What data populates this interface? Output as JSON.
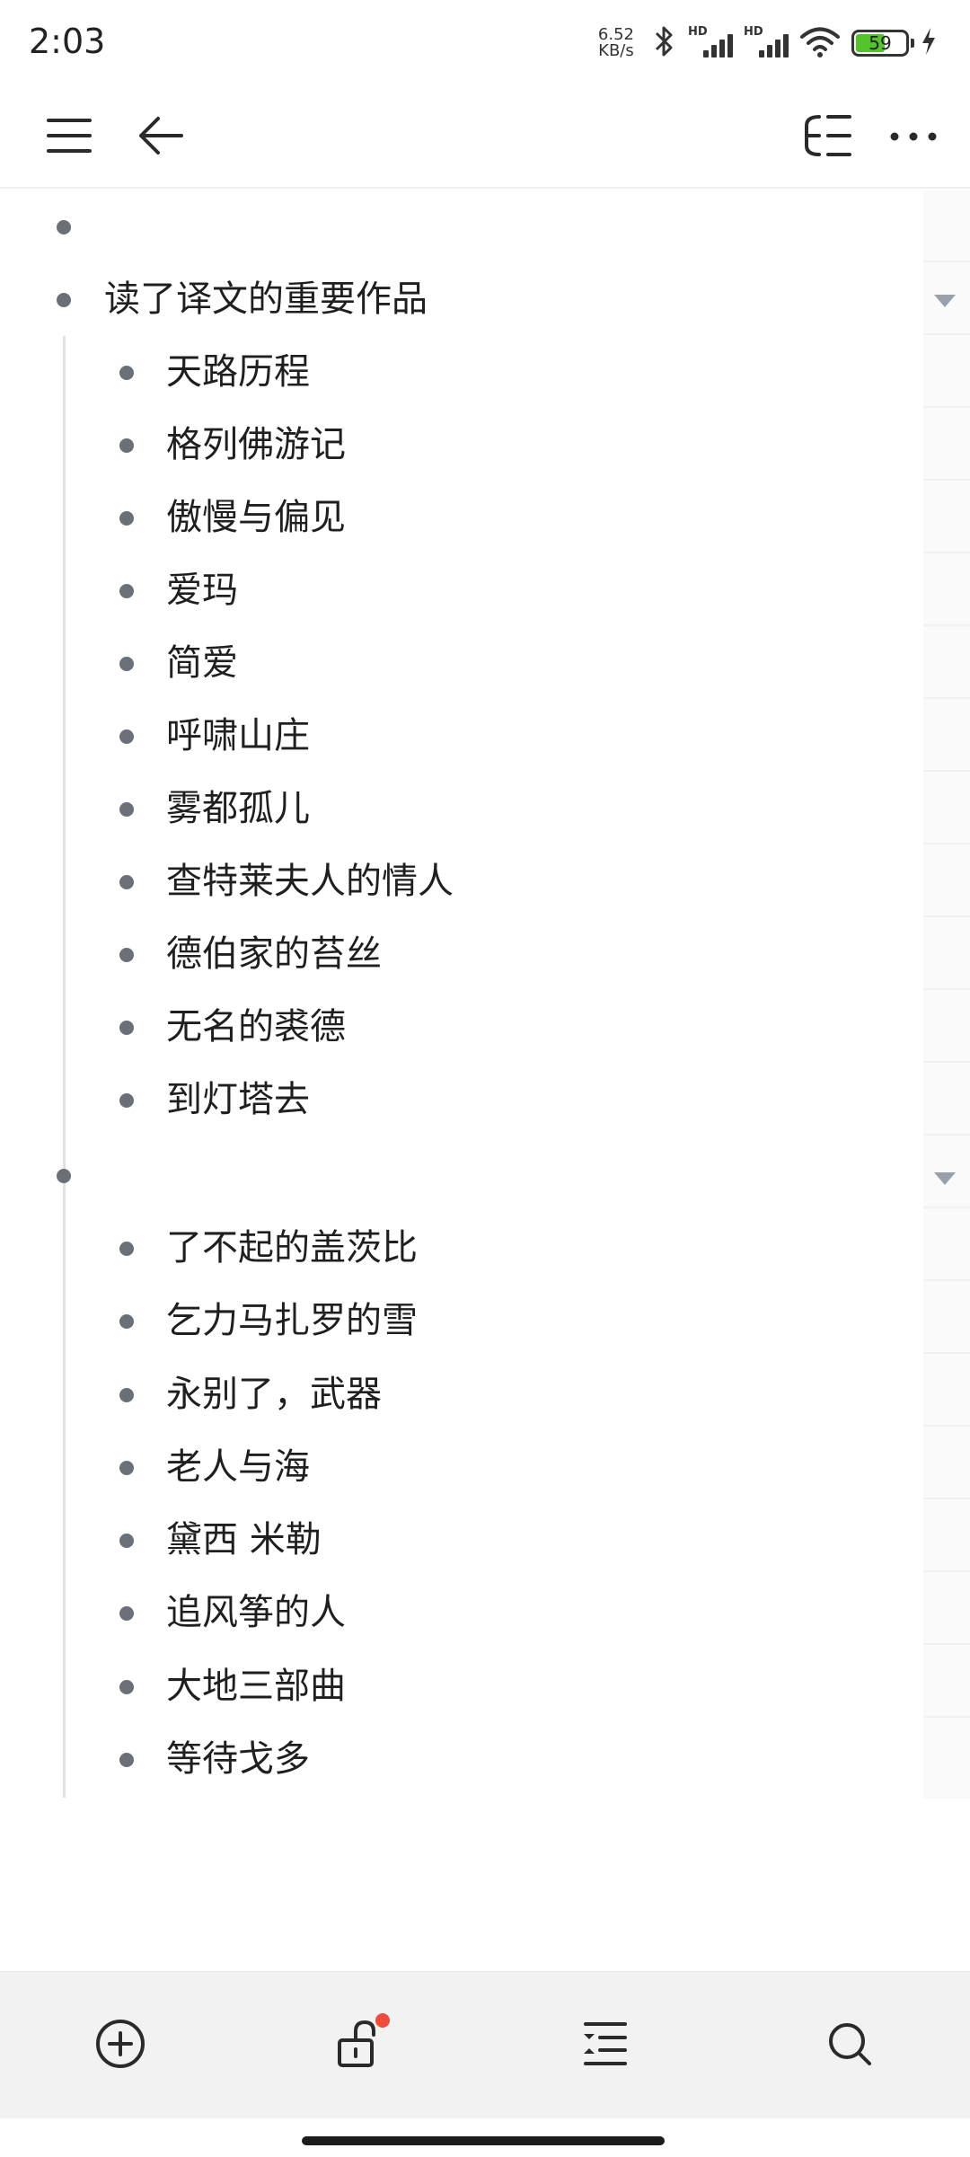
{
  "status_bar": {
    "time": "2:03",
    "net_speed_value": "6.52",
    "net_speed_unit": "KB/s",
    "hd1": "HD",
    "hd2": "HD",
    "battery_level": "59",
    "battery_fraction": 0.59
  },
  "header": {
    "menu_icon": "hamburger-menu-icon",
    "back_icon": "arrow-left-icon",
    "mindmap_icon": "mindmap-icon",
    "more_icon": "more-horizontal-icon"
  },
  "outline": {
    "items": [
      {
        "text": "",
        "level": 0
      },
      {
        "text": "读了译文的重要作品",
        "level": 0,
        "collapsible": true
      },
      {
        "text": "天路历程",
        "level": 1
      },
      {
        "text": "格列佛游记",
        "level": 1
      },
      {
        "text": "傲慢与偏见",
        "level": 1
      },
      {
        "text": "爱玛",
        "level": 1
      },
      {
        "text": "简爱",
        "level": 1
      },
      {
        "text": "呼啸山庄",
        "level": 1
      },
      {
        "text": "雾都孤儿",
        "level": 1
      },
      {
        "text": "查特莱夫人的情人",
        "level": 1
      },
      {
        "text": "德伯家的苔丝",
        "level": 1
      },
      {
        "text": "无名的裘德",
        "level": 1
      },
      {
        "text": "到灯塔去",
        "level": 1
      },
      {
        "text": "",
        "level": 0,
        "collapsible": true
      },
      {
        "text": "了不起的盖茨比",
        "level": 1
      },
      {
        "text": "乞力马扎罗的雪",
        "level": 1
      },
      {
        "text": "永别了，武器",
        "level": 1
      },
      {
        "text": "老人与海",
        "level": 1
      },
      {
        "text": "黛西 米勒",
        "level": 1
      },
      {
        "text": "追风筝的人",
        "level": 1
      },
      {
        "text": "大地三部曲",
        "level": 1
      },
      {
        "text": "等待戈多",
        "level": 1
      }
    ]
  },
  "toolbar": {
    "add_icon": "add-circle-icon",
    "unlock_icon": "unlock-icon",
    "indent_icon": "indent-list-icon",
    "search_icon": "search-icon"
  },
  "colors": {
    "bullet": "#6b6f77",
    "toolbar_bg": "#f2f2f3",
    "badge": "#f04b3b",
    "battery": "#53c22b"
  }
}
